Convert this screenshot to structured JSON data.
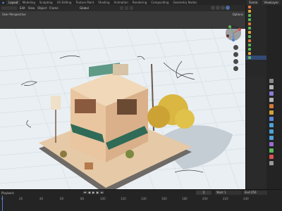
{
  "topbar": {
    "tabs": [
      "Layout",
      "Modeling",
      "Sculpting",
      "UV Editing",
      "Texture Paint",
      "Shading",
      "Animation",
      "Rendering",
      "Compositing",
      "Geometry Nodes"
    ],
    "scene_label": "Scene",
    "view_layer": "ViewLayer"
  },
  "header": {
    "menus": [
      "Edit",
      "View",
      "Object",
      "Frame"
    ],
    "transform_orientation": "Global",
    "options_label": "Options"
  },
  "viewport": {
    "label": "User Perspective"
  },
  "timeline": {
    "playback_label": "Playback",
    "current_frame": "1",
    "start_label": "Start",
    "start_value": "1",
    "end_label": "End",
    "end_value": "250",
    "ruler_ticks": [
      "0",
      "20",
      "40",
      "60",
      "80",
      "100",
      "120",
      "140",
      "160",
      "180",
      "200",
      "220",
      "240"
    ],
    "play_buttons": [
      "⏮",
      "◀",
      "▶",
      "▶",
      "⏭"
    ]
  },
  "colors": {
    "accent": "#4f7fd6",
    "background": "#1d1d1d",
    "canvas": "#e9eff3",
    "tree": "#d9b740"
  }
}
